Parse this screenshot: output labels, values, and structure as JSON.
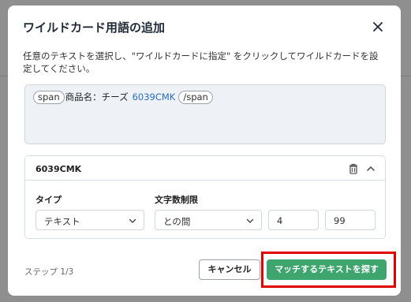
{
  "dialog": {
    "title": "ワイルドカード用語の追加",
    "instructions": "任意のテキストを選択し、\"ワイルドカードに指定\" をクリックしてワイルドカードを設定してください。"
  },
  "preview": {
    "open_tag": "span",
    "text": "商品名：チーズ",
    "wildcard": "6039CMK",
    "close_tag": "/span"
  },
  "wildcard_panel": {
    "title": "6039CMK",
    "type_label": "タイプ",
    "type_value": "テキスト",
    "length_label": "文字数制限",
    "length_mode": "との間",
    "min_value": "4",
    "max_value": "99"
  },
  "footer": {
    "step": "ステップ 1/3",
    "cancel_label": "キャンセル",
    "primary_label": "マッチするテキストを探す"
  },
  "colors": {
    "primary": "#3fa56f",
    "highlight_border": "#e00000",
    "wildcard_text": "#2b6cc4"
  },
  "icons": [
    "close-icon",
    "trash-icon",
    "chevron-up-icon",
    "chevron-down-icon"
  ]
}
